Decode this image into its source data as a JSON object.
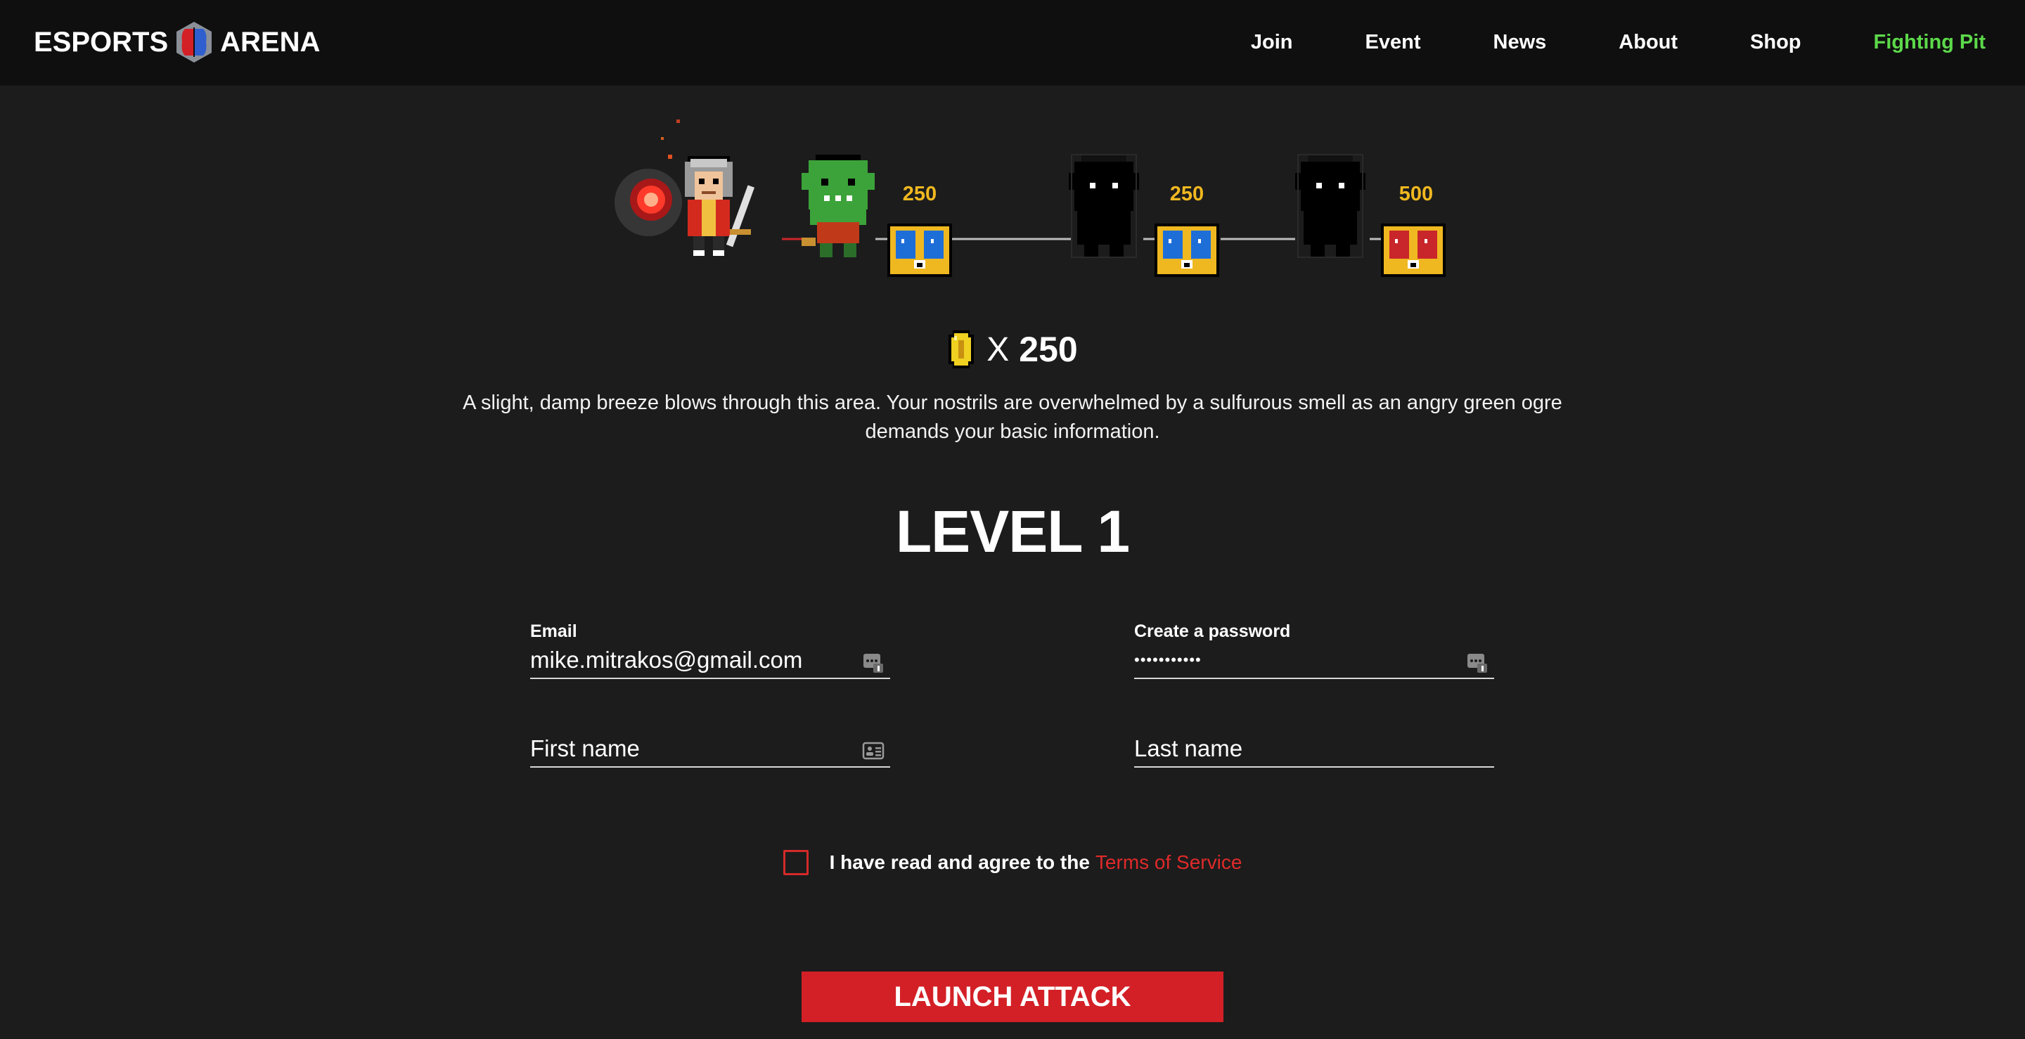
{
  "brand": {
    "left_word": "ESPORTS",
    "right_word": "ARENA"
  },
  "nav": {
    "items": [
      {
        "label": "Join"
      },
      {
        "label": "Event"
      },
      {
        "label": "News"
      },
      {
        "label": "About"
      },
      {
        "label": "Shop"
      },
      {
        "label": "Fighting Pit"
      }
    ],
    "active_label": "Fighting Pit",
    "active_color": "#5cd94a"
  },
  "progress": {
    "stages": [
      {
        "enemy": "green ogre",
        "reward": "250",
        "chest": "blue-chest-icon"
      },
      {
        "enemy": "shadow ogre (locked)",
        "reward": "250",
        "chest": "blue-chest-icon"
      },
      {
        "enemy": "shadow ogre (locked)",
        "reward": "500",
        "chest": "red-chest-icon"
      }
    ]
  },
  "coins": {
    "x_label": "X",
    "count": "250"
  },
  "story": "A slight, damp breeze blows through this area. Your nostrils are overwhelmed by a sulfurous smell as an angry green ogre demands your basic information.",
  "level_title": "LEVEL 1",
  "form": {
    "email_label": "Email",
    "email_value": "mike.mitrakos@gmail.com",
    "password_label": "Create a password",
    "password_value": "•••••••••••",
    "first_name_placeholder": "First name",
    "last_name_placeholder": "Last name"
  },
  "tos": {
    "text": "I have read and agree to the",
    "link": "Terms of Service",
    "checked": false
  },
  "submit_label": "LAUNCH ATTACK",
  "colors": {
    "background": "#1c1c1c",
    "header": "#0f0f0f",
    "accent_red": "#d32026",
    "gold": "#f0b820"
  }
}
